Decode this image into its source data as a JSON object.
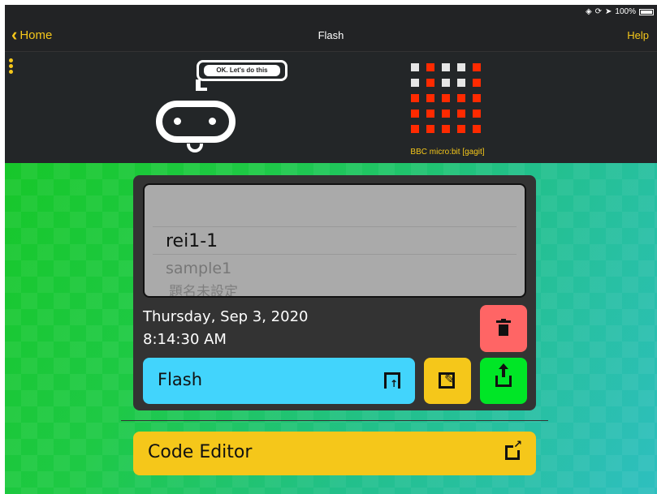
{
  "status_bar": {
    "icons": [
      "wifi-icon",
      "orientation-lock-icon",
      "location-icon"
    ],
    "battery_text": "100%"
  },
  "nav": {
    "back_label": "Home",
    "title": "Flash",
    "help_label": "Help"
  },
  "header": {
    "speech_bubble": "OK. Let's do this",
    "device_name": "BBC micro:bit [gagit]",
    "led_pattern": [
      [
        0,
        1,
        0,
        0,
        1
      ],
      [
        0,
        1,
        0,
        0,
        1
      ],
      [
        1,
        1,
        1,
        1,
        1
      ],
      [
        1,
        1,
        1,
        1,
        1
      ],
      [
        1,
        1,
        1,
        1,
        1
      ]
    ],
    "colors": {
      "led_on": "#ff2a00",
      "led_off": "#e6e6e6",
      "accent": "#f5c71a"
    }
  },
  "project_picker": {
    "selected": "rei1-1",
    "items_below": [
      "sample1",
      "題名未設定"
    ]
  },
  "project_info": {
    "date": "Thursday, Sep 3, 2020",
    "time": "8:14:30 AM"
  },
  "actions": {
    "flash_label": "Flash",
    "flash_color": "#42d4fc",
    "delete_color": "#ff6565",
    "edit_color": "#f5c71a",
    "share_color": "#00e626"
  },
  "code_editor": {
    "label": "Code Editor"
  }
}
